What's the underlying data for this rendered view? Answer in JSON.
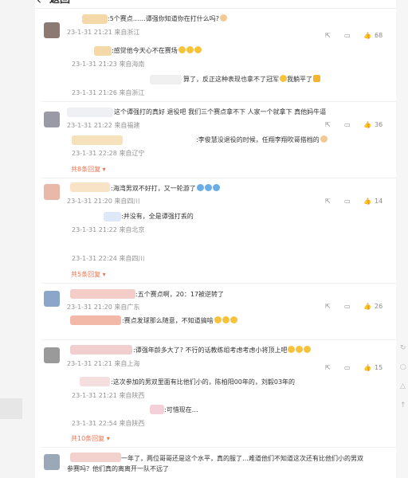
{
  "header": {
    "back_label": "返回",
    "back_icon": "‹"
  },
  "comments": [
    {
      "avatar_color": "#8c7a72",
      "text": ":5个赛点……谭强你知道你在打什么吗?",
      "time": "23-1-31 21:21 来自浙江",
      "likes": "68",
      "replies": [
        {
          "text": ":感觉他今天心不在赛场",
          "time": "23-1-31 21:23 来自海南"
        },
        {
          "text": "算了，反正这种表现也拿不了冠军",
          "text2": "我躺平了",
          "time": "23-1-31 21:26 来自浙江"
        }
      ]
    },
    {
      "avatar_color": "#9a9aa6",
      "text": "这个谭强打的真好    退役吧    我们三个赛点拿不下    人家一个就拿下    真他妈牛逼",
      "time": "23-1-31 21:22 来自福建",
      "likes": "36",
      "replies": [
        {
          "text": ":李俊慧没退役的时候，任翔李翔吹哥搭档的",
          "time": "23-1-31 22:28 来自辽宁"
        }
      ],
      "more": "共8条回复"
    },
    {
      "avatar_color": "#e8b8a8",
      "text": ":海湾男双不好打，又一轮游了",
      "time": "23-1-31 21:20 来自四川",
      "likes": "14",
      "replies": [
        {
          "text": ":并没有，全是谭强打丢的",
          "time": "23-1-31 21:22 来自北京"
        },
        {
          "text": "",
          "time": "23-1-31 22:24 来自四川"
        }
      ],
      "more": "共5条回复"
    },
    {
      "avatar_color": "#8aa6c8",
      "text": ":五个赛点啊，20：17被逆转了",
      "time": "23-1-31 21:20 来自广东",
      "likes": "26",
      "replies": [
        {
          "text": ":赛点发球那么随意，不知道搞啥",
          "time": ""
        }
      ]
    },
    {
      "avatar_color": "#9a9a9a",
      "text": ":谭强年龄多大了? 不行的话教练组考虑考虑小将顶上吧",
      "time": "23-1-31 21:21 来自上海",
      "likes": "15",
      "replies": [
        {
          "text": ":这次参加的男双里面有比他们小的，陈柏阳00年的，刘毅03年的",
          "time": "23-1-31 21:21 来自陕西"
        },
        {
          "text": ":可惜现在…",
          "time": "23-1-31 22:54 来自陕西"
        }
      ],
      "more": "共10条回复"
    },
    {
      "avatar_color": "#9aa8b8",
      "text": "一年了，两位哥哥还是这个水平，真的服了…难道他们不知道这次还有比他们小的男双",
      "text2": "参赛吗？他们真的离离开一队不远了",
      "time": "",
      "likes": ""
    }
  ],
  "icons": {
    "share": "share-icon",
    "comment": "comment-icon",
    "like": "like-icon",
    "refresh": "refresh-icon",
    "chevron": "chevron-down-icon"
  }
}
